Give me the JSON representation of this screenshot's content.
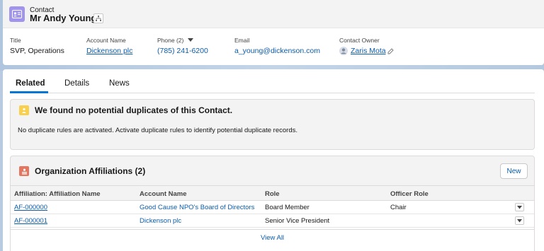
{
  "header": {
    "object_label": "Contact",
    "record_name": "Mr Andy Young",
    "contact_icon": "contact-card-icon",
    "hierarchy_icon": "hierarchy-icon"
  },
  "highlights": {
    "title": {
      "label": "Title",
      "value": "SVP, Operations"
    },
    "account_name": {
      "label": "Account Name",
      "value": "Dickenson plc"
    },
    "phone": {
      "label": "Phone (2)",
      "value": "(785) 241-6200"
    },
    "email": {
      "label": "Email",
      "value": "a_young@dickenson.com"
    },
    "owner": {
      "label": "Contact Owner",
      "value": "Zaris Mota"
    }
  },
  "tabs": [
    {
      "label": "Related",
      "active": true
    },
    {
      "label": "Details",
      "active": false
    },
    {
      "label": "News",
      "active": false
    }
  ],
  "duplicates": {
    "title": "We found no potential duplicates of this Contact.",
    "message": "No duplicate rules are activated. Activate duplicate rules to identify potential duplicate records."
  },
  "affiliations": {
    "title": "Organization Affiliations (2)",
    "new_label": "New",
    "columns": [
      "Affiliation: Affiliation Name",
      "Account Name",
      "Role",
      "Officer Role"
    ],
    "rows": [
      {
        "name": "AF-000000",
        "account": "Good Cause NPO's Board of Directors",
        "role": "Board Member",
        "officer_role": "Chair"
      },
      {
        "name": "AF-000001",
        "account": "Dickenson plc",
        "role": "Senior Vice President",
        "officer_role": ""
      }
    ],
    "view_all": "View All"
  },
  "colors": {
    "accent": "#0176d3",
    "link": "#0b5cab",
    "contact_icon_bg": "#a094ed",
    "duplicate_icon_bg": "#f9d04c",
    "affiliation_icon_bg": "#e5755f"
  }
}
